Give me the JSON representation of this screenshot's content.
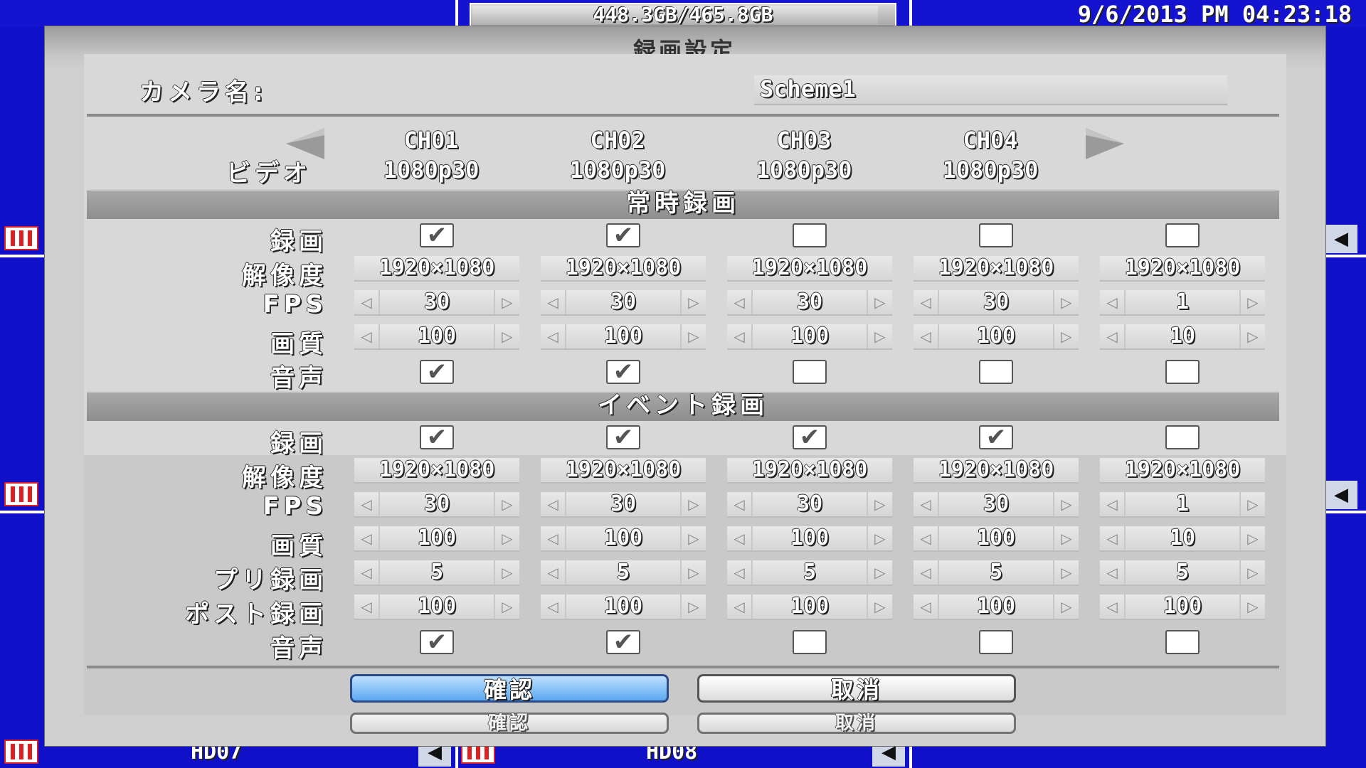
{
  "status": {
    "storage": "448.3GB/465.8GB",
    "storage_fraction": 0.962,
    "datetime": "9/6/2013 PM 04:23:18"
  },
  "bottom": {
    "cam7": "HD07",
    "cam8": "HD08"
  },
  "icons": {
    "record": "film-icon",
    "audio": "speaker-icon",
    "prev": "arrow-left-icon",
    "next": "arrow-right-icon"
  },
  "dialog": {
    "title": "録画設定",
    "camera_name_label": "カメラ名:",
    "camera_name_value": "Scheme1",
    "video_label": "ビデオ",
    "channels": [
      {
        "name": "CH01",
        "mode": "1080p30"
      },
      {
        "name": "CH02",
        "mode": "1080p30"
      },
      {
        "name": "CH03",
        "mode": "1080p30"
      },
      {
        "name": "CH04",
        "mode": "1080p30"
      }
    ],
    "continuous": {
      "title": "常時録画",
      "labels": {
        "record": "録画",
        "resolution": "解像度",
        "fps": "FPS",
        "quality": "画質",
        "audio": "音声"
      },
      "columns": [
        {
          "record": true,
          "resolution": "1920×1080",
          "fps": "30",
          "quality": "100",
          "audio": true
        },
        {
          "record": true,
          "resolution": "1920×1080",
          "fps": "30",
          "quality": "100",
          "audio": true
        },
        {
          "record": false,
          "resolution": "1920×1080",
          "fps": "30",
          "quality": "100",
          "audio": false
        },
        {
          "record": false,
          "resolution": "1920×1080",
          "fps": "30",
          "quality": "100",
          "audio": false
        },
        {
          "record": false,
          "resolution": "1920×1080",
          "fps": "1",
          "quality": "10",
          "audio": false
        }
      ]
    },
    "event": {
      "title": "イベント録画",
      "labels": {
        "record": "録画",
        "resolution": "解像度",
        "fps": "FPS",
        "quality": "画質",
        "pre": "プリ録画",
        "post": "ポスト録画",
        "audio": "音声"
      },
      "columns": [
        {
          "record": true,
          "resolution": "1920×1080",
          "fps": "30",
          "quality": "100",
          "pre": "5",
          "post": "100",
          "audio": true
        },
        {
          "record": true,
          "resolution": "1920×1080",
          "fps": "30",
          "quality": "100",
          "pre": "5",
          "post": "100",
          "audio": true
        },
        {
          "record": true,
          "resolution": "1920×1080",
          "fps": "30",
          "quality": "100",
          "pre": "5",
          "post": "100",
          "audio": false
        },
        {
          "record": true,
          "resolution": "1920×1080",
          "fps": "30",
          "quality": "100",
          "pre": "5",
          "post": "100",
          "audio": false
        },
        {
          "record": false,
          "resolution": "1920×1080",
          "fps": "1",
          "quality": "10",
          "pre": "5",
          "post": "100",
          "audio": false
        }
      ]
    },
    "buttons": {
      "confirm": "確認",
      "cancel": "取消"
    },
    "ghost_buttons": {
      "confirm": "確認",
      "cancel": "取消"
    },
    "arrows": {
      "left": "◀",
      "right": "▶",
      "spin_left": "◁",
      "spin_right": "▷",
      "check": "✔"
    }
  }
}
